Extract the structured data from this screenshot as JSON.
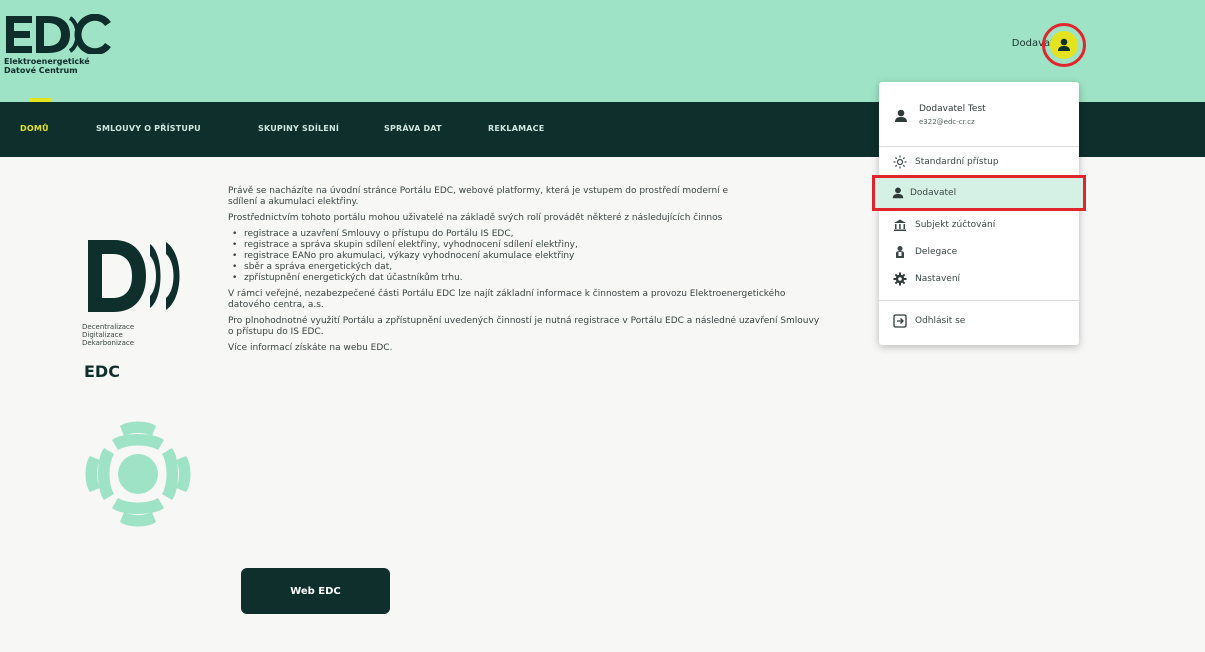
{
  "brand": {
    "logo_letters": "EDC",
    "line1": "Elektroenergetické",
    "line2": "Datové Centrum",
    "colors": {
      "header": "#9ee3c6",
      "nav": "#0e2f2b",
      "accent": "#e4e320",
      "highlight": "#e0252d"
    }
  },
  "header": {
    "user_label": "Dodavatel",
    "avatar_icon": "person-icon"
  },
  "nav": {
    "items": [
      {
        "label": "DOMŮ",
        "active": true
      },
      {
        "label": "SMLOUVY O PŘÍSTUPU"
      },
      {
        "label": "SKUPINY SDÍLENÍ"
      },
      {
        "label": "SPRÁVA DAT"
      },
      {
        "label": "REKLAMACE"
      }
    ]
  },
  "side": {
    "tagline": [
      "Decentralizace",
      "Digitalizace",
      "Dekarbonizace"
    ],
    "edc": "EDC"
  },
  "content": {
    "p1": "Právě se nacházíte na úvodní stránce Portálu EDC, webové platformy, která je vstupem do prostředí moderní e",
    "p1b": "sdílení a akumulaci elektřiny.",
    "p2": "Prostřednictvím tohoto portálu mohou uživatelé na základě svých rolí provádět některé z následujících činnos",
    "bullets": [
      "registrace a uzavření Smlouvy o přístupu do Portálu IS EDC,",
      "registrace a správa skupin sdílení elektřiny, vyhodnocení sdílení elektřiny,",
      "registrace EANo pro akumulaci, výkazy vyhodnocení akumulace elektřiny",
      "sběr a správa energetických dat,",
      "zpřístupnění energetických dat účastníkům trhu."
    ],
    "p3": "V rámci veřejné, nezabezpečené části Portálu EDC lze najít základní informace k činnostem a provozu Elektroenergetického",
    "p3b": "datového centra, a.s.",
    "p4": "Pro plnohodnotné využití Portálu a zpřístupnění uvedených činností je nutná registrace v Portálu EDC a následné uzavření Smlouvy",
    "p4b": "o přístupu do IS EDC.",
    "p5": "Více informací získáte na webu EDC.",
    "button": "Web EDC"
  },
  "menu": {
    "user_name": "Dodavatel Test",
    "user_email": "e322@edc-cr.cz",
    "items": [
      {
        "label": "Standardní přístup",
        "icon": "sun-icon"
      },
      {
        "label": "Dodavatel",
        "icon": "person-icon",
        "selected": true
      },
      {
        "label": "Subjekt zúčtování",
        "icon": "bank-icon"
      },
      {
        "label": "Delegace",
        "icon": "delegate-icon"
      },
      {
        "label": "Nastavení",
        "icon": "gear-icon"
      },
      {
        "label": "Odhlásit se",
        "icon": "logout-icon"
      }
    ]
  }
}
